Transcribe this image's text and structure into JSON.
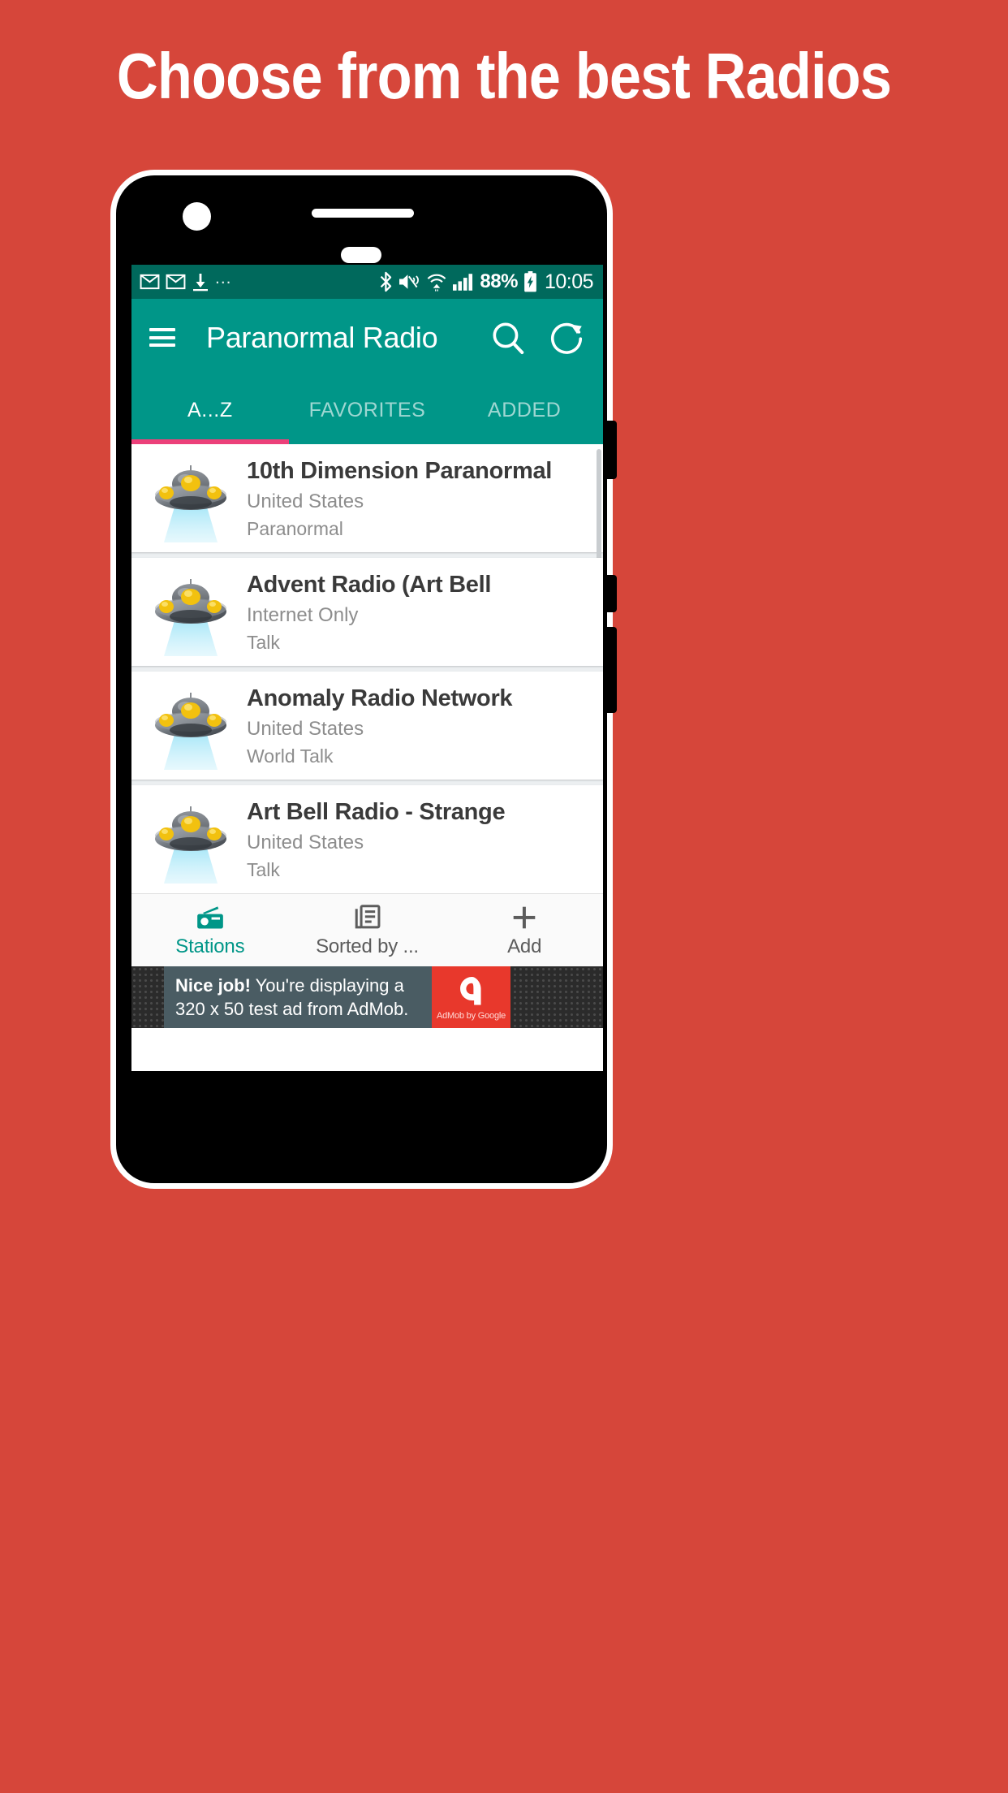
{
  "promo": {
    "headline": "Choose from the best Radios",
    "background_color": "#d6463a"
  },
  "theme": {
    "primary": "#009688",
    "primary_dark": "#00695c",
    "accent": "#ec407a",
    "ad_red": "#e8382c"
  },
  "status_bar": {
    "left_icons": [
      "gmail-icon",
      "gmail-icon",
      "download-icon"
    ],
    "more_indicator": "...",
    "right_icons": [
      "bluetooth-icon",
      "mute-vibrate-icon",
      "wifi-icon",
      "signal-icon"
    ],
    "battery_percent": "88%",
    "battery_state": "charging",
    "time": "10:05"
  },
  "app_bar": {
    "menu_icon": "hamburger-icon",
    "title": "Paranormal Radio",
    "search_icon": "search-icon",
    "refresh_icon": "refresh-icon"
  },
  "tabs": {
    "items": [
      {
        "label": "A...Z",
        "active": true
      },
      {
        "label": "FAVORITES",
        "active": false
      },
      {
        "label": "ADDED",
        "active": false
      }
    ]
  },
  "stations": [
    {
      "name": "10th Dimension Paranormal",
      "country": "United States",
      "genre": "Paranormal",
      "icon": "ufo-icon"
    },
    {
      "name": "Advent Radio (Art Bell",
      "country": "Internet Only",
      "genre": "Talk",
      "icon": "ufo-icon"
    },
    {
      "name": "Anomaly Radio Network",
      "country": "United States",
      "genre": "World Talk",
      "icon": "ufo-icon"
    },
    {
      "name": "Art Bell Radio - Strange",
      "country": "United States",
      "genre": "Talk",
      "icon": "ufo-icon"
    }
  ],
  "bottom_nav": {
    "items": [
      {
        "label": "Stations",
        "icon": "radio-icon",
        "active": true
      },
      {
        "label": "Sorted by ...",
        "icon": "list-icon",
        "active": false
      },
      {
        "label": "Add",
        "icon": "plus-icon",
        "active": false
      }
    ]
  },
  "ad": {
    "lead": "Nice job!",
    "body": " You're displaying a 320 x 50 test ad from AdMob.",
    "brand": "AdMob by Google"
  }
}
